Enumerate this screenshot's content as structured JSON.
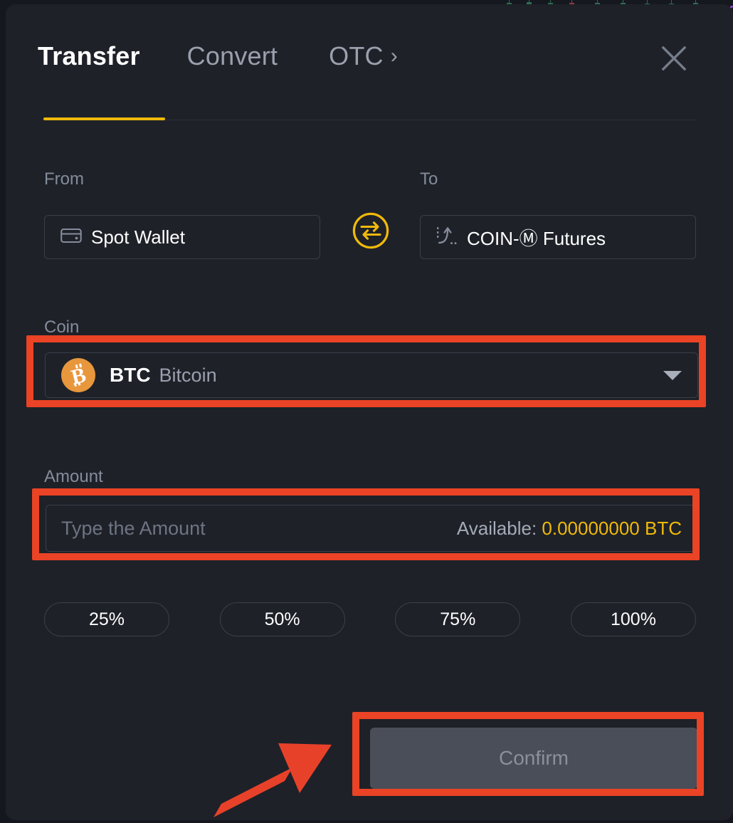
{
  "modal": {
    "tabs": [
      {
        "label": "Transfer",
        "active": true
      },
      {
        "label": "Convert",
        "active": false
      },
      {
        "label": "OTC",
        "active": false
      }
    ],
    "otc_chevron": "›",
    "close_icon": "close-icon",
    "accent_color": "#f0b90b",
    "highlight_color": "#ea4325",
    "background_color": "#1e2128"
  },
  "transfer": {
    "from": {
      "label": "From",
      "value": "Spot Wallet",
      "icon": "wallet-icon"
    },
    "to": {
      "label": "To",
      "value": "COIN-Ⓜ Futures",
      "icon": "futures-chart-icon"
    },
    "swap_icon": "swap-arrows-icon",
    "coin": {
      "label": "Coin",
      "symbol": "BTC",
      "name": "Bitcoin",
      "logo_icon": "bitcoin-icon",
      "logo_color": "#e8973d",
      "logo_glyph": "₿",
      "caret_icon": "chevron-down-icon"
    },
    "amount": {
      "label": "Amount",
      "value": "",
      "placeholder": "Type the Amount",
      "available_label": "Available:",
      "available_value": "0.00000000 BTC"
    },
    "percent_buttons": [
      {
        "label": "25%"
      },
      {
        "label": "50%"
      },
      {
        "label": "75%"
      },
      {
        "label": "100%"
      }
    ],
    "confirm": {
      "label": "Confirm",
      "disabled": true
    }
  },
  "annotations": {
    "arrow": "red-arrow-pointing-to-confirm",
    "highlighted_regions": [
      "coin-select",
      "amount-field",
      "confirm-button"
    ]
  },
  "background": {
    "chart_note": "candlestick-chart-behind-modal",
    "up_color": "#2e6b52",
    "down_color": "#8c3a46",
    "line_color": "#8e44c4"
  }
}
